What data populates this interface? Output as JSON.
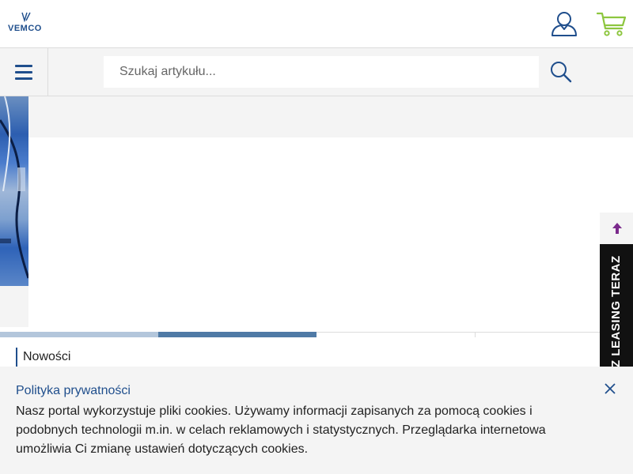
{
  "header": {
    "logo_text": "VEMCO",
    "user_icon": "user-icon",
    "cart_icon": "cart-icon"
  },
  "navbar": {
    "menu_icon": "hamburger-menu-icon",
    "search": {
      "placeholder": "Szukaj artykułu...",
      "value": ""
    },
    "search_icon": "search-icon"
  },
  "slider": {
    "segments": 4,
    "active_index": 2
  },
  "sections": {
    "new_title": "Nowości"
  },
  "side": {
    "scroll_top_icon": "arrow-up-icon",
    "leasing_label": "Z LEASING TERAZ"
  },
  "cookie": {
    "title": "Polityka prywatności",
    "text": "Nasz portal wykorzystuje pliki cookies. Używamy informacji zapisanych za pomocą cookies i podobnych technologii m.in. w celach reklamowych i statystycznych. Przeglądarka internetowa umożliwia Ci zmianę ustawień dotyczących cookies.",
    "close_icon": "close-icon"
  },
  "colors": {
    "brand_blue": "#1f4e8c",
    "cart_green": "#8dc63f",
    "arrow_purple": "#7b2a8c",
    "panel_gray": "#f4f4f4"
  }
}
